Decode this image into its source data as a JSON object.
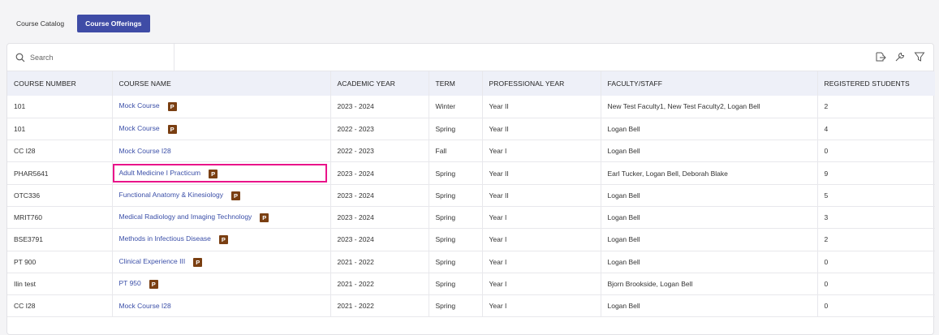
{
  "tabs": [
    {
      "label": "Course Catalog",
      "active": false
    },
    {
      "label": "Course Offerings",
      "active": true
    }
  ],
  "search": {
    "placeholder": "Search"
  },
  "toolbar_icons": [
    "export-icon",
    "wrench-icon",
    "filter-icon"
  ],
  "columns": [
    "COURSE NUMBER",
    "COURSE NAME",
    "ACADEMIC YEAR",
    "TERM",
    "PROFESSIONAL YEAR",
    "FACULTY/STAFF",
    "REGISTERED STUDENTS"
  ],
  "rows": [
    {
      "number": "101",
      "name": "Mock Course",
      "badge": "P",
      "year": "2023 - 2024",
      "term": "Winter",
      "pro_year": "Year II",
      "faculty": "New Test Faculty1, New Test Faculty2, Logan Bell",
      "students": "2"
    },
    {
      "number": "101",
      "name": "Mock Course",
      "badge": "P",
      "year": "2022 - 2023",
      "term": "Spring",
      "pro_year": "Year II",
      "faculty": "Logan Bell",
      "students": "4"
    },
    {
      "number": "CC I28",
      "name": "Mock Course I28",
      "badge": "",
      "year": "2022 - 2023",
      "term": "Fall",
      "pro_year": "Year I",
      "faculty": "Logan Bell",
      "students": "0"
    },
    {
      "number": "PHAR5641",
      "name": "Adult Medicine I Practicum",
      "badge": "P",
      "year": "2023 - 2024",
      "term": "Spring",
      "pro_year": "Year II",
      "faculty": "Earl Tucker, Logan Bell, Deborah Blake",
      "students": "9",
      "highlight": true
    },
    {
      "number": "OTC336",
      "name": "Functional Anatomy & Kinesiology",
      "badge": "P",
      "year": "2023 - 2024",
      "term": "Spring",
      "pro_year": "Year II",
      "faculty": "Logan Bell",
      "students": "5"
    },
    {
      "number": "MRIT760",
      "name": "Medical Radiology and Imaging Technology",
      "badge": "P",
      "year": "2023 - 2024",
      "term": "Spring",
      "pro_year": "Year I",
      "faculty": "Logan Bell",
      "students": "3"
    },
    {
      "number": "BSE3791",
      "name": "Methods in Infectious Disease",
      "badge": "P",
      "year": "2023 - 2024",
      "term": "Spring",
      "pro_year": "Year I",
      "faculty": "Logan Bell",
      "students": "2"
    },
    {
      "number": "PT 900",
      "name": "Clinical Experience III",
      "badge": "P",
      "year": "2021 - 2022",
      "term": "Spring",
      "pro_year": "Year I",
      "faculty": "Logan Bell",
      "students": "0"
    },
    {
      "number": "Ilin test",
      "name": "PT 950",
      "badge": "P",
      "year": "2021 - 2022",
      "term": "Spring",
      "pro_year": "Year I",
      "faculty": "Bjorn Brookside, Logan Bell",
      "students": "0"
    },
    {
      "number": "CC I28",
      "name": "Mock Course I28",
      "badge": "",
      "year": "2021 - 2022",
      "term": "Spring",
      "pro_year": "Year I",
      "faculty": "Logan Bell",
      "students": "0"
    }
  ]
}
